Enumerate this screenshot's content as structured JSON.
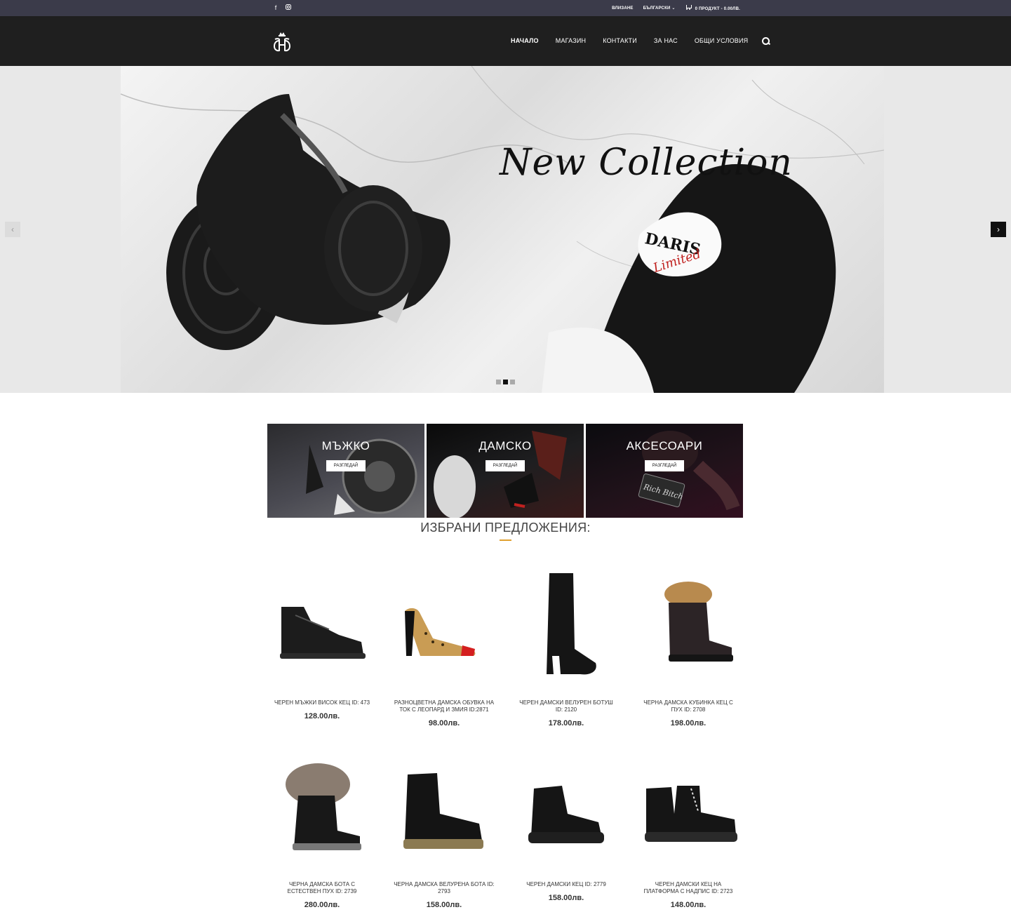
{
  "topbar": {
    "social": [
      "facebook-icon",
      "instagram-icon"
    ],
    "login": "ВЛИЗАНЕ",
    "language": "БЪЛГАРСКИ",
    "cart": "0 ПРОДУКТ - 0.00ЛВ."
  },
  "nav": {
    "items": [
      "НАЧАЛО",
      "МАГАЗИН",
      "КОНТАКТИ",
      "ЗА НАС",
      "ОБЩИ УСЛОВИЯ"
    ],
    "active": "НАЧАЛО"
  },
  "slider": {
    "title": "New Collection",
    "brand_text": "DARIS Limited",
    "slides": 3,
    "current": 2
  },
  "categories": [
    {
      "label": "МЪЖКО",
      "button": "РАЗГЛЕДАЙ"
    },
    {
      "label": "ДАМСКО",
      "button": "РАЗГЛЕДАЙ"
    },
    {
      "label": "АКСЕСОАРИ",
      "button": "РАЗГЛЕДАЙ"
    }
  ],
  "featured": {
    "title": "ИЗБРАНИ ПРЕДЛОЖЕНИЯ:"
  },
  "products": [
    {
      "name": "ЧЕРЕН МЪЖКИ ВИСОК КЕЦ ID: 473",
      "price": "128.00лв.",
      "icon": "sneaker-high-icon"
    },
    {
      "name": "РАЗНОЦВЕТНА ДАМСКА ОБУВКА НА ТОК С ЛЕОПАРД И ЗМИЯ ID:2871",
      "price": "98.00лв.",
      "icon": "pump-icon"
    },
    {
      "name": "ЧЕРЕН ДАМСКИ ВЕЛУРЕН БОТУШ ID: 2120",
      "price": "178.00лв.",
      "icon": "knee-boot-icon"
    },
    {
      "name": "ЧЕРНА ДАМСКА КУБИНКА КЕЦ С ПУХ ID: 2708",
      "price": "198.00лв.",
      "icon": "fur-boot-icon"
    },
    {
      "name": "ЧЕРНА ДАМСКА БОТА С ЕСТЕСТВЕН ПУХ ID: 2739",
      "price": "280.00лв.",
      "icon": "fur-boot-icon"
    },
    {
      "name": "ЧЕРНА ДАМСКА ВЕЛУРЕНА БОТА ID: 2793",
      "price": "158.00лв.",
      "icon": "ankle-boot-icon"
    },
    {
      "name": "ЧЕРЕН ДАМСКИ КЕЦ ID: 2779",
      "price": "158.00лв.",
      "icon": "chunky-sneaker-icon"
    },
    {
      "name": "ЧЕРЕН ДАМСКИ КЕЦ НА ПЛАТФОРМА С НАДПИС ID: 2723",
      "price": "148.00лв.",
      "icon": "platform-sneaker-icon"
    }
  ]
}
